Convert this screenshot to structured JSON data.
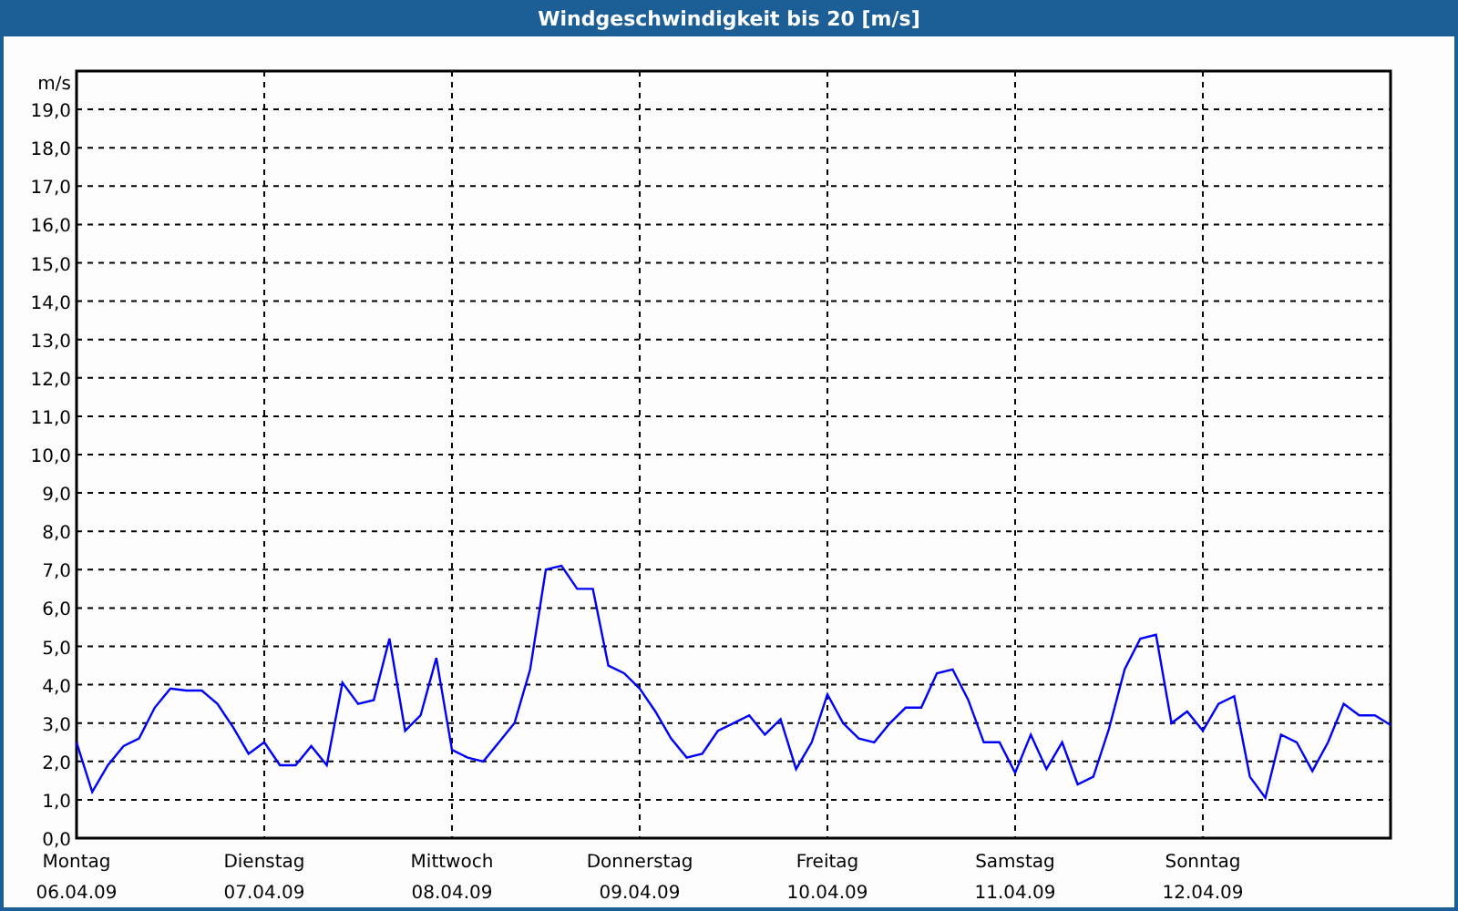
{
  "window": {
    "title": "Windgeschwindigkeit bis 20 [m/s]"
  },
  "chart": {
    "date_labels": [
      "06.04.09",
      "07.04.09",
      "08.04.09",
      "09.04.09",
      "10.04.09",
      "11.04.09",
      "12.04.09"
    ],
    "chart_data": {
      "type": "line",
      "ylabel": "m/s",
      "categories": [
        "Montag",
        null,
        null,
        null,
        null,
        null,
        null,
        null,
        null,
        null,
        null,
        null,
        "Dienstag",
        null,
        null,
        null,
        null,
        null,
        null,
        null,
        null,
        null,
        null,
        null,
        "Mittwoch",
        null,
        null,
        null,
        null,
        null,
        null,
        null,
        null,
        null,
        null,
        null,
        "Donnerstag",
        null,
        null,
        null,
        null,
        null,
        null,
        null,
        null,
        null,
        null,
        null,
        "Freitag",
        null,
        null,
        null,
        null,
        null,
        null,
        null,
        null,
        null,
        null,
        null,
        "Samstag",
        null,
        null,
        null,
        null,
        null,
        null,
        null,
        null,
        null,
        null,
        null,
        "Sonntag",
        null,
        null,
        null,
        null,
        null,
        null,
        null,
        null,
        null,
        null,
        null,
        null
      ],
      "series": [
        {
          "color": "#0000ff",
          "values": [
            2.5,
            1.2,
            1.9,
            2.4,
            2.6,
            3.4,
            3.9,
            3.85,
            3.85,
            3.5,
            2.9,
            2.2,
            2.5,
            1.9,
            1.9,
            2.4,
            1.9,
            4.05,
            3.5,
            3.6,
            5.2,
            2.8,
            3.2,
            4.7,
            2.3,
            2.1,
            2.0,
            2.5,
            3.0,
            4.4,
            7.0,
            7.1,
            6.5,
            6.5,
            4.5,
            4.3,
            3.9,
            3.3,
            2.6,
            2.1,
            2.2,
            2.8,
            3.0,
            3.2,
            2.7,
            3.1,
            1.8,
            2.5,
            3.75,
            3.0,
            2.6,
            2.5,
            3.0,
            3.4,
            3.4,
            4.3,
            4.4,
            3.6,
            2.5,
            2.5,
            1.7,
            2.7,
            1.8,
            2.5,
            1.4,
            1.6,
            2.85,
            4.4,
            5.2,
            5.3,
            3.0,
            3.3,
            2.8,
            3.5,
            3.7,
            1.6,
            1.05,
            2.7,
            2.5,
            1.75,
            2.5,
            3.5,
            3.2,
            3.2,
            2.95
          ]
        }
      ],
      "ylim": [
        0,
        20
      ],
      "grid": true,
      "yticks": [
        {
          "value": 0,
          "label": "0,0"
        },
        {
          "value": 1,
          "label": "1,0"
        },
        {
          "value": 2,
          "label": "2,0"
        },
        {
          "value": 3,
          "label": "3,0"
        },
        {
          "value": 4,
          "label": "4,0"
        },
        {
          "value": 5,
          "label": "5,0"
        },
        {
          "value": 6,
          "label": "6,0"
        },
        {
          "value": 7,
          "label": "7,0"
        },
        {
          "value": 8,
          "label": "8,0"
        },
        {
          "value": 9,
          "label": "9,0"
        },
        {
          "value": 10,
          "label": "10,0"
        },
        {
          "value": 11,
          "label": "11,0"
        },
        {
          "value": 12,
          "label": "12,0"
        },
        {
          "value": 13,
          "label": "13,0"
        },
        {
          "value": 14,
          "label": "14,0"
        },
        {
          "value": 15,
          "label": "15,0"
        },
        {
          "value": 16,
          "label": "16,0"
        },
        {
          "value": 17,
          "label": "17,0"
        },
        {
          "value": 18,
          "label": "18,0"
        },
        {
          "value": 19,
          "label": "19,0"
        }
      ]
    }
  }
}
